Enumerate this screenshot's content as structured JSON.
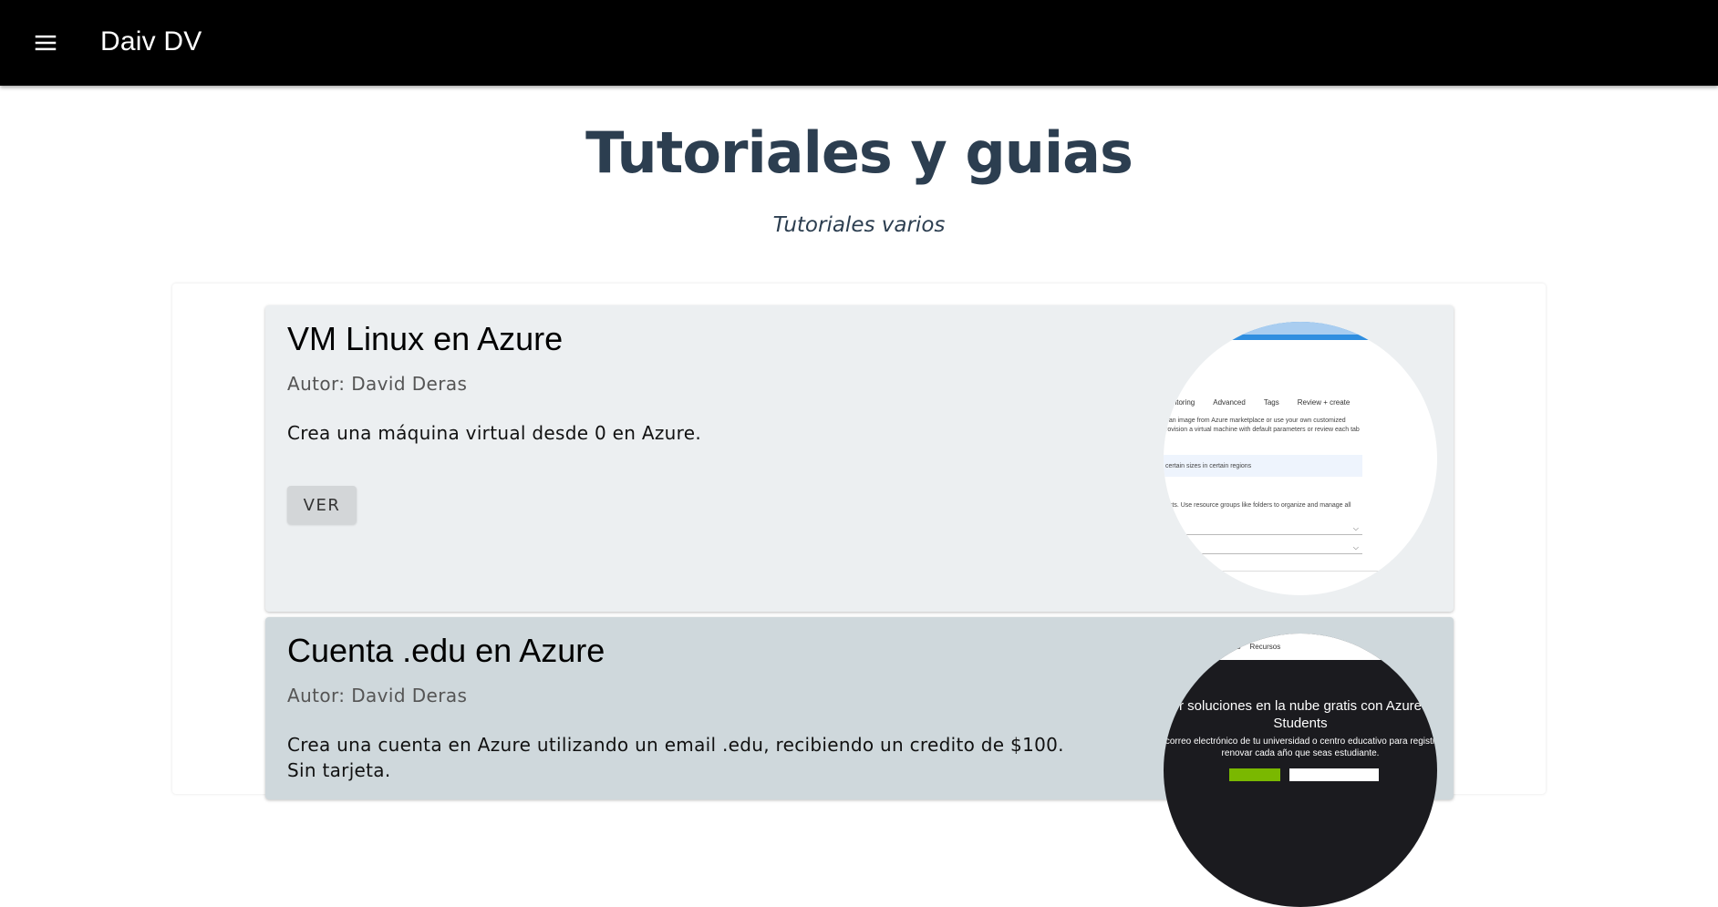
{
  "appbar": {
    "menu_icon": "hamburger-menu-icon",
    "title": "Daiv DV",
    "background": "#000000"
  },
  "page": {
    "title": "Tutoriales y guias",
    "subtitle": "Tutoriales varios",
    "title_color": "#2c3e50"
  },
  "cards": [
    {
      "title": "VM Linux en Azure",
      "author": "Autor: David Deras",
      "description": "Crea una máquina virtual desde 0 en Azure.",
      "button_label": "VER",
      "background": "#eceff1",
      "thumbnail": {
        "tabs": [
          "nitoring",
          "Advanced",
          "Tags",
          "Review + create"
        ],
        "line1": "t an image from Azure marketplace or use your own customized",
        "line2": "rovision a virtual machine with default parameters or review each tab",
        "info": "certain sizes in certain regions",
        "line3": "osts. Use resource groups like folders to organize and manage all"
      }
    },
    {
      "title": "Cuenta .edu en Azure",
      "author": "Autor: David Deras",
      "description": "Crea una cuenta en Azure utilizando un email .edu, recibiendo un credito de $100.",
      "description_line2": "Sin tarjeta.",
      "background": "#cfd8dc",
      "thumbnail": {
        "nav": [
          "cos",
          "Recursos"
        ],
        "headline": "r soluciones en la nube gratis con Azure Students",
        "small": "correo electrónico de tu universidad o centro educativo para registr renovar cada año que seas estudiante."
      }
    }
  ]
}
